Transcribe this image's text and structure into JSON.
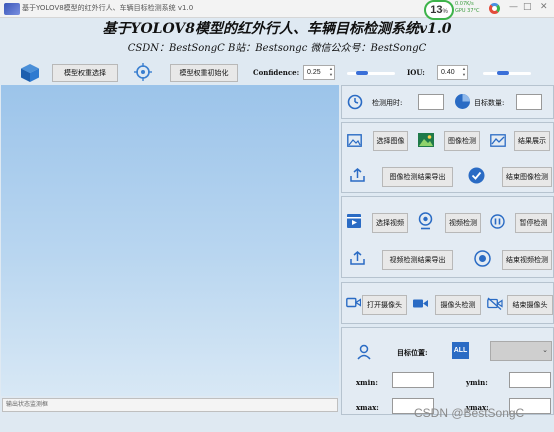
{
  "window": {
    "title": "基于YOLOV8模型的红外行人、车辆目标检测系统 v1.0",
    "cpu_usage": "13",
    "cpu_unit": "%",
    "net_speed": "0.07K/s",
    "gpu_temp": "GPU 37°C",
    "minimize": "—",
    "maximize": "□",
    "close": "✕"
  },
  "header": {
    "title": "基于YOLOV8模型的红外行人、车辆目标检测系统v1.0",
    "subtitle": "CSDN：BestSongC   B站：Bestsongc   微信公众号：BestSongC"
  },
  "toolbar": {
    "select_weights": "模型权重选择",
    "init_weights": "模型权重初始化",
    "confidence_label": "Confidence:",
    "confidence_value": "0.25",
    "iou_label": "IOU:",
    "iou_value": "0.40"
  },
  "stats": {
    "time_label": "检测用时:",
    "time_value": "",
    "count_label": "目标数量:",
    "count_value": ""
  },
  "image_panel": {
    "select_image": "选择图像",
    "detect_image": "图像检测",
    "show_result": "结果展示",
    "export_image": "图像检测结果导出",
    "end_image": "结束图像检测"
  },
  "video_panel": {
    "select_video": "选择视频",
    "detect_video": "视频检测",
    "pause_detect": "暂停检测",
    "export_video": "视频检测结果导出",
    "end_video": "结束视频检测"
  },
  "camera_panel": {
    "open_camera": "打开摄像头",
    "camera_detect": "摄像头检测",
    "end_camera": "结束摄像头"
  },
  "position_panel": {
    "target_pos_label": "目标位置:",
    "all_badge": "ALL",
    "select_value": "",
    "xmin_label": "xmin:",
    "ymin_label": "ymin:",
    "xmax_label": "xmax:",
    "ymax_label": "ymax:"
  },
  "log": {
    "placeholder": "输出状态监测框"
  },
  "watermark": "CSDN @BestSongC",
  "sliders": {
    "confidence": 0.25,
    "iou": 0.4
  }
}
